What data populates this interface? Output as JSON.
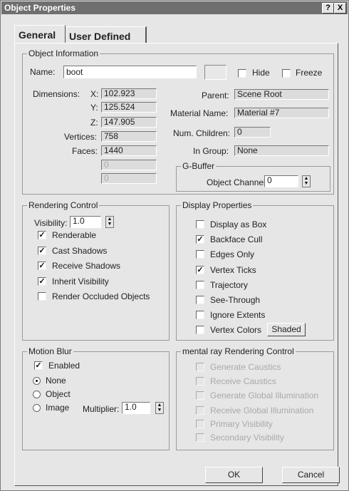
{
  "window": {
    "title": "Object Properties",
    "help": "?",
    "close": "X"
  },
  "tabs": [
    "General",
    "User Defined"
  ],
  "object_info": {
    "title": "Object Information",
    "name_label": "Name:",
    "name_value": "boot",
    "hide_label": "Hide",
    "freeze_label": "Freeze",
    "dimensions_label": "Dimensions:",
    "x_label": "X:",
    "x_value": "102.923",
    "y_label": "Y:",
    "y_value": "125.524",
    "z_label": "Z:",
    "z_value": "147.905",
    "vertices_label": "Vertices:",
    "vertices_value": "758",
    "faces_label": "Faces:",
    "faces_value": "1440",
    "extra1": "0",
    "extra2": "0",
    "parent_label": "Parent:",
    "parent_value": "Scene Root",
    "material_label": "Material Name:",
    "material_value": "Material #7",
    "children_label": "Num. Children:",
    "children_value": "0",
    "group_label": "In Group:",
    "group_value": "None"
  },
  "gbuffer": {
    "title": "G-Buffer",
    "channel_label": "Object Channel:",
    "channel_value": "0"
  },
  "rendering": {
    "title": "Rendering Control",
    "visibility_label": "Visibility:",
    "visibility_value": "1.0",
    "options": [
      {
        "label": "Renderable",
        "checked": true
      },
      {
        "label": "Cast Shadows",
        "checked": true
      },
      {
        "label": "Receive Shadows",
        "checked": true
      },
      {
        "label": "Inherit Visibility",
        "checked": true
      },
      {
        "label": "Render Occluded Objects",
        "checked": false
      }
    ]
  },
  "display": {
    "title": "Display Properties",
    "options": [
      {
        "label": "Display as Box",
        "checked": false
      },
      {
        "label": "Backface Cull",
        "checked": true
      },
      {
        "label": "Edges Only",
        "checked": false
      },
      {
        "label": "Vertex Ticks",
        "checked": true
      },
      {
        "label": "Trajectory",
        "checked": false
      },
      {
        "label": "See-Through",
        "checked": false
      },
      {
        "label": "Ignore Extents",
        "checked": false
      },
      {
        "label": "Vertex Colors",
        "checked": false
      }
    ],
    "shaded_button": "Shaded"
  },
  "motion_blur": {
    "title": "Motion Blur",
    "enabled_label": "Enabled",
    "enabled_checked": true,
    "radios": [
      {
        "label": "None",
        "selected": true
      },
      {
        "label": "Object",
        "selected": false
      },
      {
        "label": "Image",
        "selected": false
      }
    ],
    "multiplier_label": "Multiplier:",
    "multiplier_value": "1.0"
  },
  "mental_ray": {
    "title": "mental ray Rendering Control",
    "options": [
      {
        "label": "Generate Caustics"
      },
      {
        "label": "Receive Caustics"
      },
      {
        "label": "Generate Global Illumination"
      },
      {
        "label": "Receive Global Illumination"
      },
      {
        "label": "Primary Visibility"
      },
      {
        "label": "Secondary Visibility"
      }
    ]
  },
  "buttons": {
    "ok": "OK",
    "cancel": "Cancel"
  }
}
